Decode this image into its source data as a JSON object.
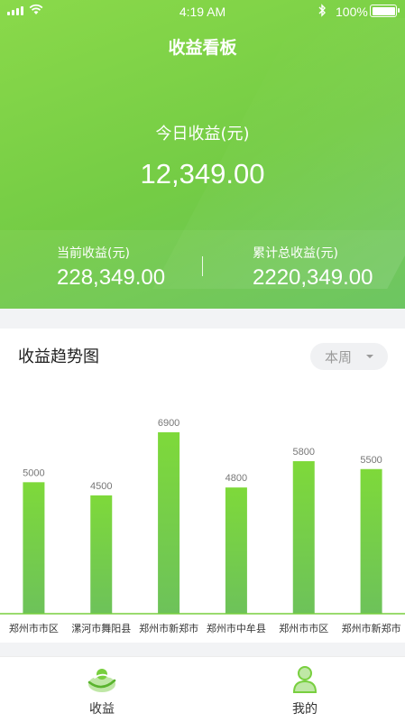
{
  "status_bar": {
    "time": "4:19 AM",
    "battery": "100%"
  },
  "header": {
    "title": "收益看板"
  },
  "today": {
    "label": "今日收益(元)",
    "value": "12,349.00"
  },
  "current": {
    "label": "当前收益(元)",
    "value": "228,349.00"
  },
  "total": {
    "label": "累计总收益(元)",
    "value": "2220,349.00"
  },
  "trend": {
    "title": "收益趋势图",
    "period": "本周"
  },
  "colors": {
    "accent": "#78cf3f",
    "bar_top": "#7ed93a",
    "bar_bottom": "#6dc25a"
  },
  "chart_data": {
    "type": "bar",
    "categories": [
      "郑州市市区",
      "漯河市舞阳县",
      "郑州市新郑市",
      "郑州市中牟县",
      "郑州市市区",
      "郑州市新郑市"
    ],
    "values": [
      5000,
      4500,
      6900,
      4800,
      5800,
      5500
    ],
    "ylim": [
      0,
      8100
    ],
    "grid": false,
    "legend": "none"
  },
  "tabbar": {
    "items": [
      {
        "label": "收益",
        "icon": "earnings-icon"
      },
      {
        "label": "我的",
        "icon": "profile-icon"
      }
    ]
  }
}
